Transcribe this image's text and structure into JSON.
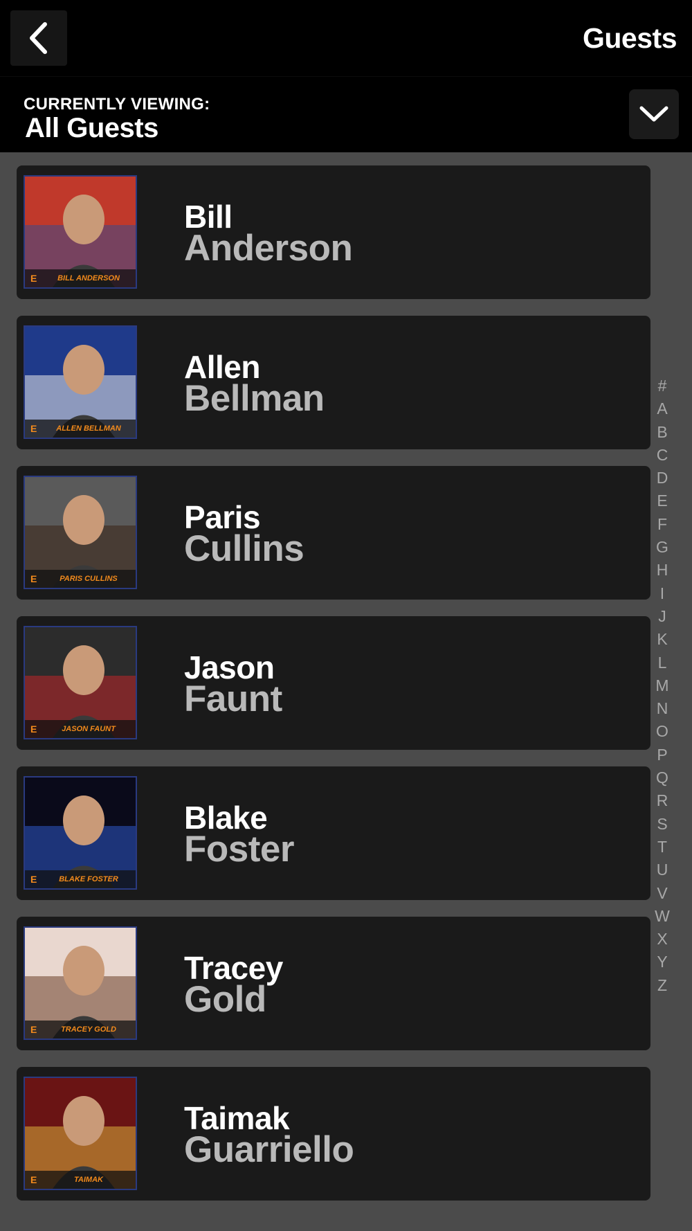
{
  "header": {
    "title": "Guests",
    "back_icon": "chevron-left-icon"
  },
  "filter": {
    "label": "CURRENTLY VIEWING:",
    "value": "All Guests",
    "toggle_icon": "chevron-down-icon"
  },
  "guests": [
    {
      "first": "Bill",
      "last": "Anderson",
      "caption": "BILL ANDERSON",
      "photo_bg": "#c0392b",
      "photo_accent": "#3a4a8a"
    },
    {
      "first": "Allen",
      "last": "Bellman",
      "caption": "ALLEN BELLMAN",
      "photo_bg": "#1f3a8a",
      "photo_accent": "#e8e8e8"
    },
    {
      "first": "Paris",
      "last": "Cullins",
      "caption": "PARIS CULLINS",
      "photo_bg": "#5a5a5a",
      "photo_accent": "#3b2416"
    },
    {
      "first": "Jason",
      "last": "Faunt",
      "caption": "JASON FAUNT",
      "photo_bg": "#2c2c2c",
      "photo_accent": "#c0262a"
    },
    {
      "first": "Blake",
      "last": "Foster",
      "caption": "BLAKE FOSTER",
      "photo_bg": "#0a0a1a",
      "photo_accent": "#2d57c9"
    },
    {
      "first": "Tracey",
      "last": "Gold",
      "caption": "TRACEY GOLD",
      "photo_bg": "#e9d7cf",
      "photo_accent": "#6b3f2a"
    },
    {
      "first": "Taimak",
      "last": "Guarriello",
      "caption": "TAIMAK",
      "photo_bg": "#6a1414",
      "photo_accent": "#d8ad3b"
    }
  ],
  "photo_caption_color": "#f28a1c",
  "alphabet_index": [
    "#",
    "A",
    "B",
    "C",
    "D",
    "E",
    "F",
    "G",
    "H",
    "I",
    "J",
    "K",
    "L",
    "M",
    "N",
    "O",
    "P",
    "Q",
    "R",
    "S",
    "T",
    "U",
    "V",
    "W",
    "X",
    "Y",
    "Z"
  ]
}
